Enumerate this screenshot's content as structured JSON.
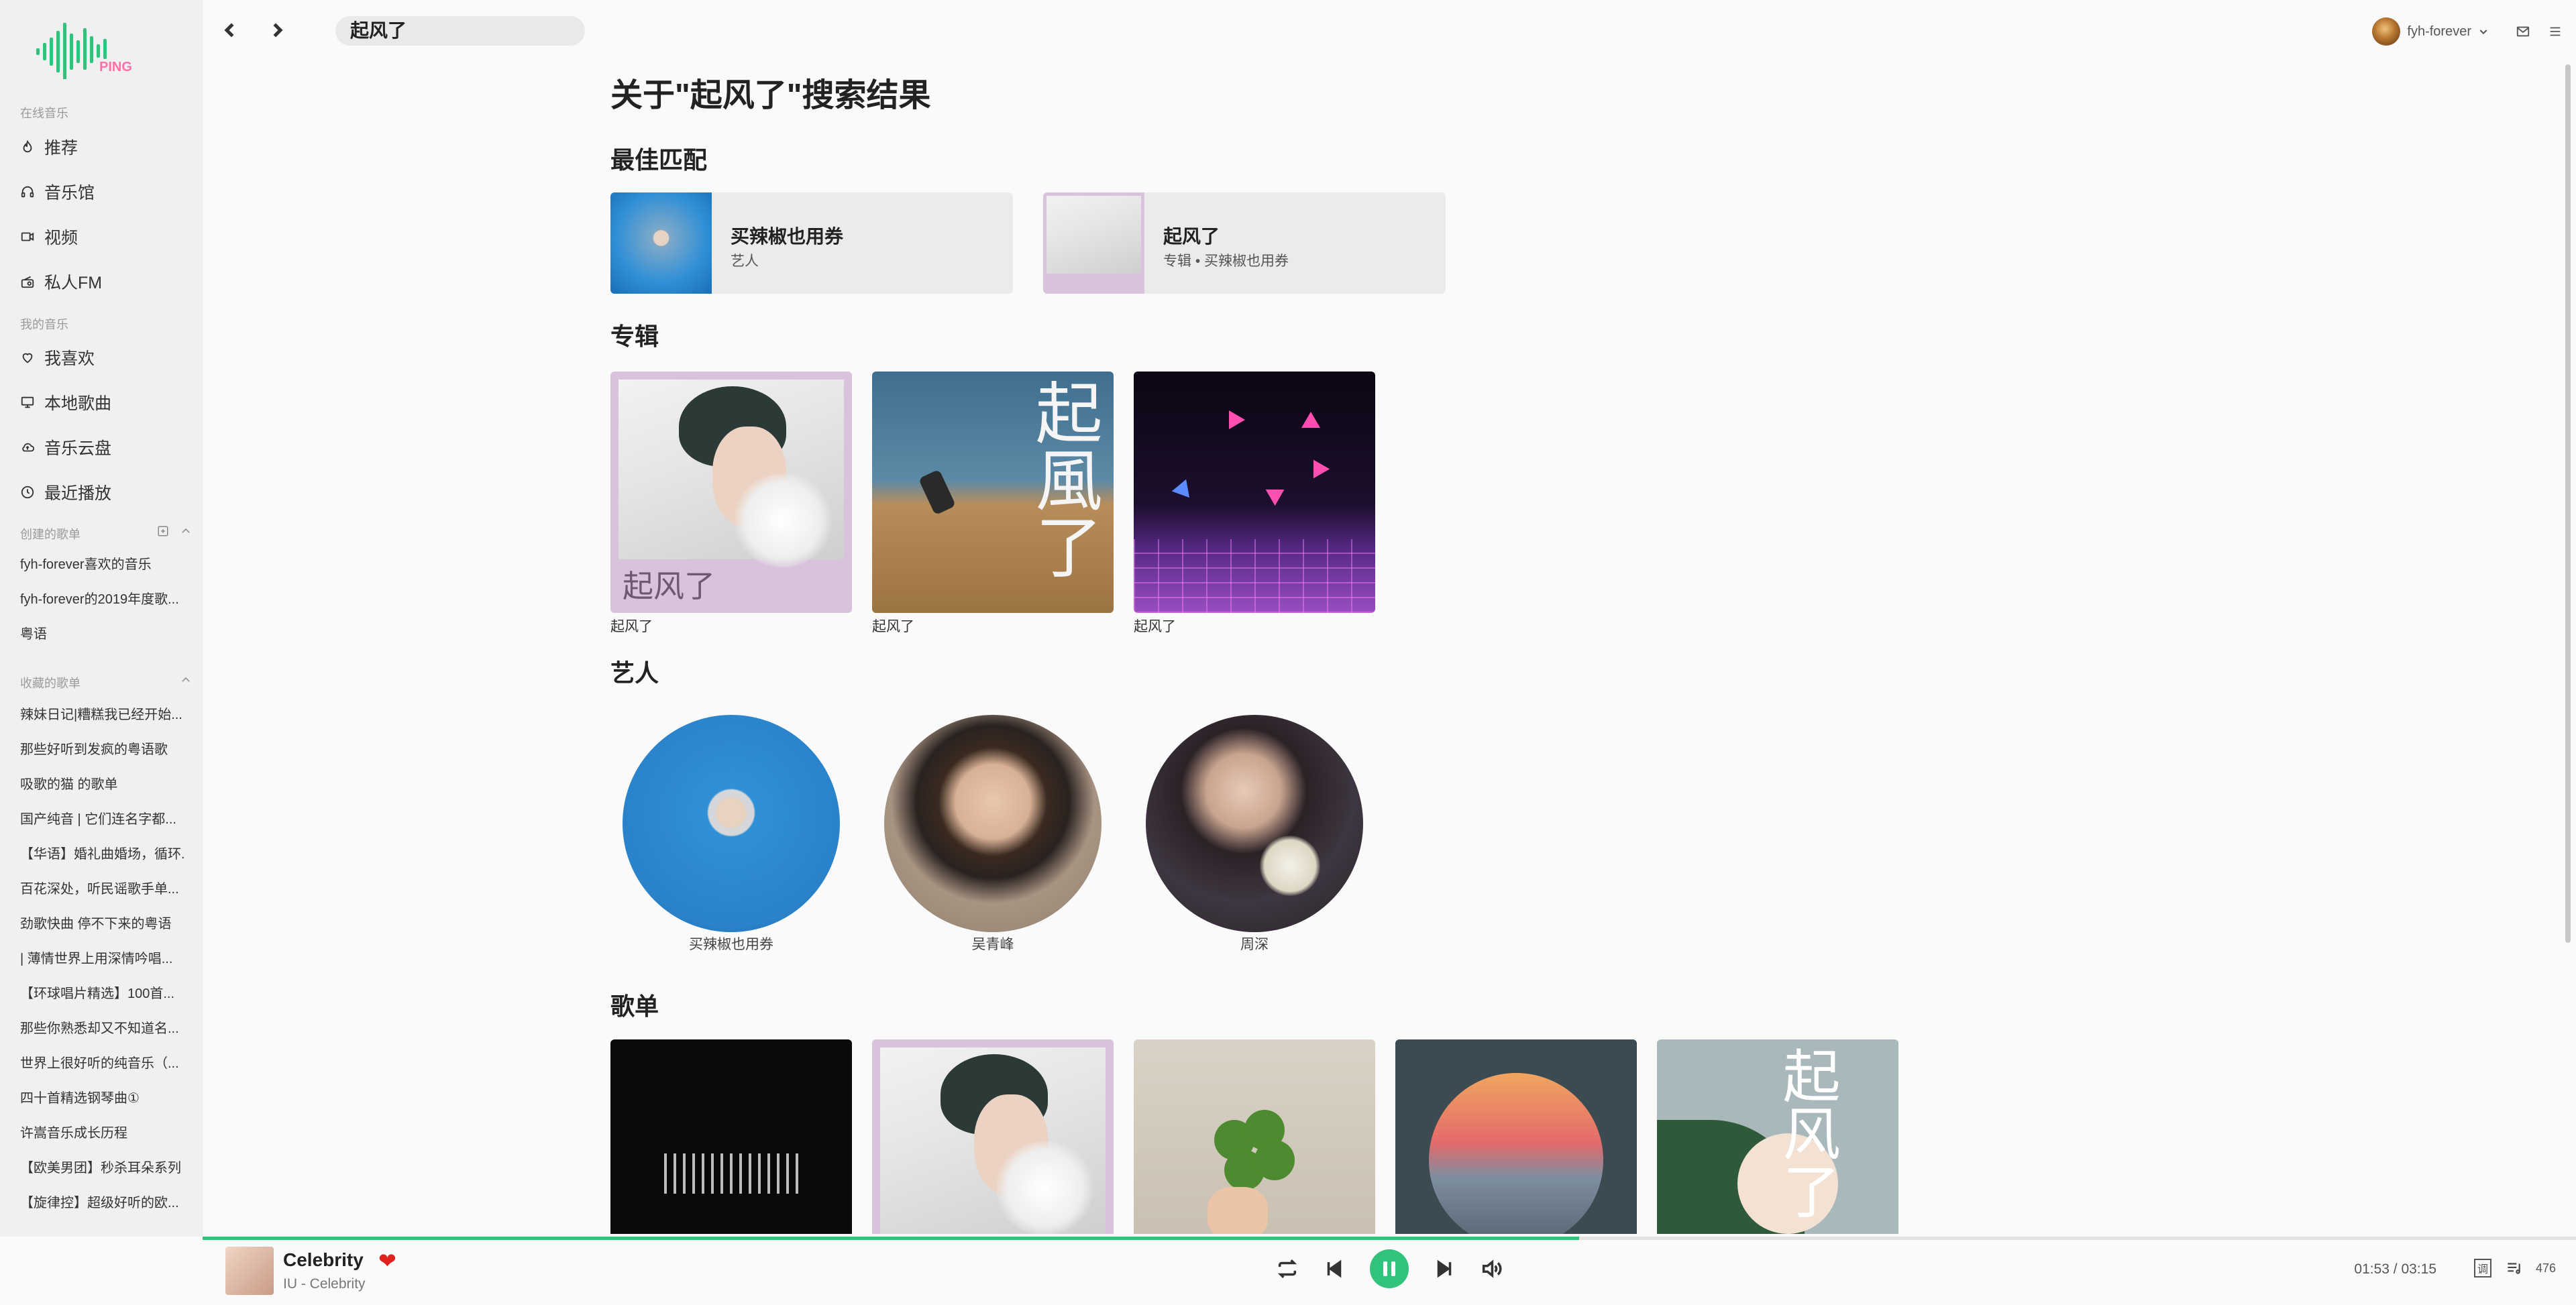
{
  "app": {
    "logo_text": "PING"
  },
  "search": {
    "query": "起风了"
  },
  "user": {
    "name": "fyh-forever"
  },
  "sidebar": {
    "online_title": "在线音乐",
    "online_items": [
      {
        "label": "推荐",
        "icon": "flame-icon"
      },
      {
        "label": "音乐馆",
        "icon": "headphones-icon"
      },
      {
        "label": "视频",
        "icon": "video-icon"
      },
      {
        "label": "私人FM",
        "icon": "radio-icon"
      }
    ],
    "my_title": "我的音乐",
    "my_items": [
      {
        "label": "我喜欢",
        "icon": "heart-icon"
      },
      {
        "label": "本地歌曲",
        "icon": "monitor-icon"
      },
      {
        "label": "音乐云盘",
        "icon": "cloud-icon"
      },
      {
        "label": "最近播放",
        "icon": "clock-icon"
      }
    ],
    "created_title": "创建的歌单",
    "created": [
      "fyh-forever喜欢的音乐",
      "fyh-forever的2019年度歌...",
      "粤语"
    ],
    "collected_title": "收藏的歌单",
    "collected": [
      "辣妹日记|糟糕我已经开始...",
      "那些好听到发疯的粤语歌",
      "吸歌的猫 的歌单",
      "国产纯音 | 它们连名字都...",
      "【华语】婚礼曲婚场，循环...",
      "百花深处，听民谣歌手单...",
      "劲歌快曲 停不下来的粤语",
      "| 薄情世界上用深情吟唱...",
      "【环球唱片精选】100首...",
      "那些你熟悉却又不知道名...",
      "世界上很好听的纯音乐（...",
      "四十首精选钢琴曲①",
      "许嵩音乐成长历程",
      "【欧美男团】秒杀耳朵系列",
      "【旋律控】超级好听的欧..."
    ]
  },
  "results": {
    "heading": "关于\"起风了\"搜索结果",
    "best_match_title": "最佳匹配",
    "best_match": [
      {
        "title": "买辣椒也用券",
        "subtitle": "艺人"
      },
      {
        "title": "起风了",
        "subtitle": "专辑 • 买辣椒也用券"
      }
    ],
    "albums_title": "专辑",
    "albums": [
      {
        "name": "起风了",
        "art_text": "起风了"
      },
      {
        "name": "起风了",
        "art_text": "起風了"
      },
      {
        "name": "起风了"
      }
    ],
    "artists_title": "艺人",
    "artists": [
      "买辣椒也用券",
      "吴青峰",
      "周深"
    ],
    "playlists_title": "歌单",
    "playlist_art_text": "起风了"
  },
  "player": {
    "title": "Celebrity",
    "artist_line": "IU - Celebrity",
    "time": "01:53 / 03:15",
    "progress": 0.58,
    "queue_label": "调",
    "count": "476",
    "liked": true,
    "accent": "#31c27c"
  }
}
